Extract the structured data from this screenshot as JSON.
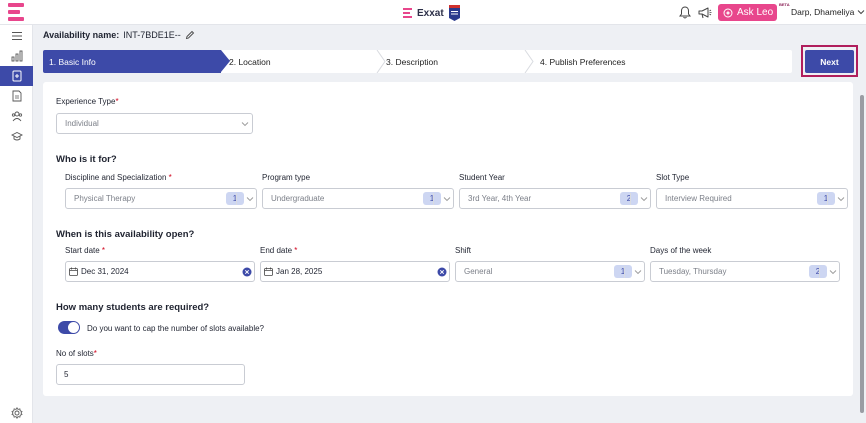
{
  "header": {
    "brand": "Exxat",
    "ask_leo": "Ask Leo",
    "beta": "BETA",
    "user": "Darp, Dhameliya"
  },
  "page": {
    "availability_label": "Availability name:",
    "availability_value": "INT-7BDE1E--"
  },
  "steps": [
    {
      "label": "1. Basic Info",
      "active": true
    },
    {
      "label": "2. Location",
      "active": false
    },
    {
      "label": "3. Description",
      "active": false
    },
    {
      "label": "4. Publish Preferences",
      "active": false
    }
  ],
  "next_label": "Next",
  "form": {
    "experience_type": {
      "label": "Experience Type",
      "value": "Individual"
    },
    "who_title": "Who is it for?",
    "discipline": {
      "label": "Discipline and Specialization ",
      "value": "Physical Therapy",
      "count": "1"
    },
    "program_type": {
      "label": "Program type",
      "value": "Undergraduate",
      "count": "1"
    },
    "student_year": {
      "label": "Student Year",
      "value": "3rd Year, 4th Year",
      "count": "2"
    },
    "slot_type": {
      "label": "Slot Type",
      "value": "Interview Required",
      "count": "1"
    },
    "when_title": "When is this availability open?",
    "start_date": {
      "label": "Start date ",
      "value": "Dec 31, 2024"
    },
    "end_date": {
      "label": "End date ",
      "value": "Jan 28, 2025"
    },
    "shift": {
      "label": "Shift",
      "value": "General",
      "count": "1"
    },
    "days": {
      "label": "Days of the week",
      "value": "Tuesday, Thursday",
      "count": "2"
    },
    "how_many_title": "How many students are required?",
    "cap_toggle": {
      "label": "Do you want to cap the number of slots available?",
      "on": true
    },
    "slots": {
      "label": "No of slots",
      "value": "5"
    }
  },
  "colors": {
    "primary": "#3d4aa8",
    "accent_pink": "#e8468c",
    "highlight_frame": "#b01e5c",
    "required": "#d0021b"
  },
  "icons": [
    "app-logo-icon",
    "bell-icon",
    "megaphone-icon",
    "leo-icon",
    "chevron-down-icon",
    "menu-icon",
    "chart-icon",
    "availability-icon",
    "document-icon",
    "users-icon",
    "graduation-icon",
    "settings-icon",
    "pencil-icon",
    "calendar-icon",
    "clear-icon"
  ]
}
